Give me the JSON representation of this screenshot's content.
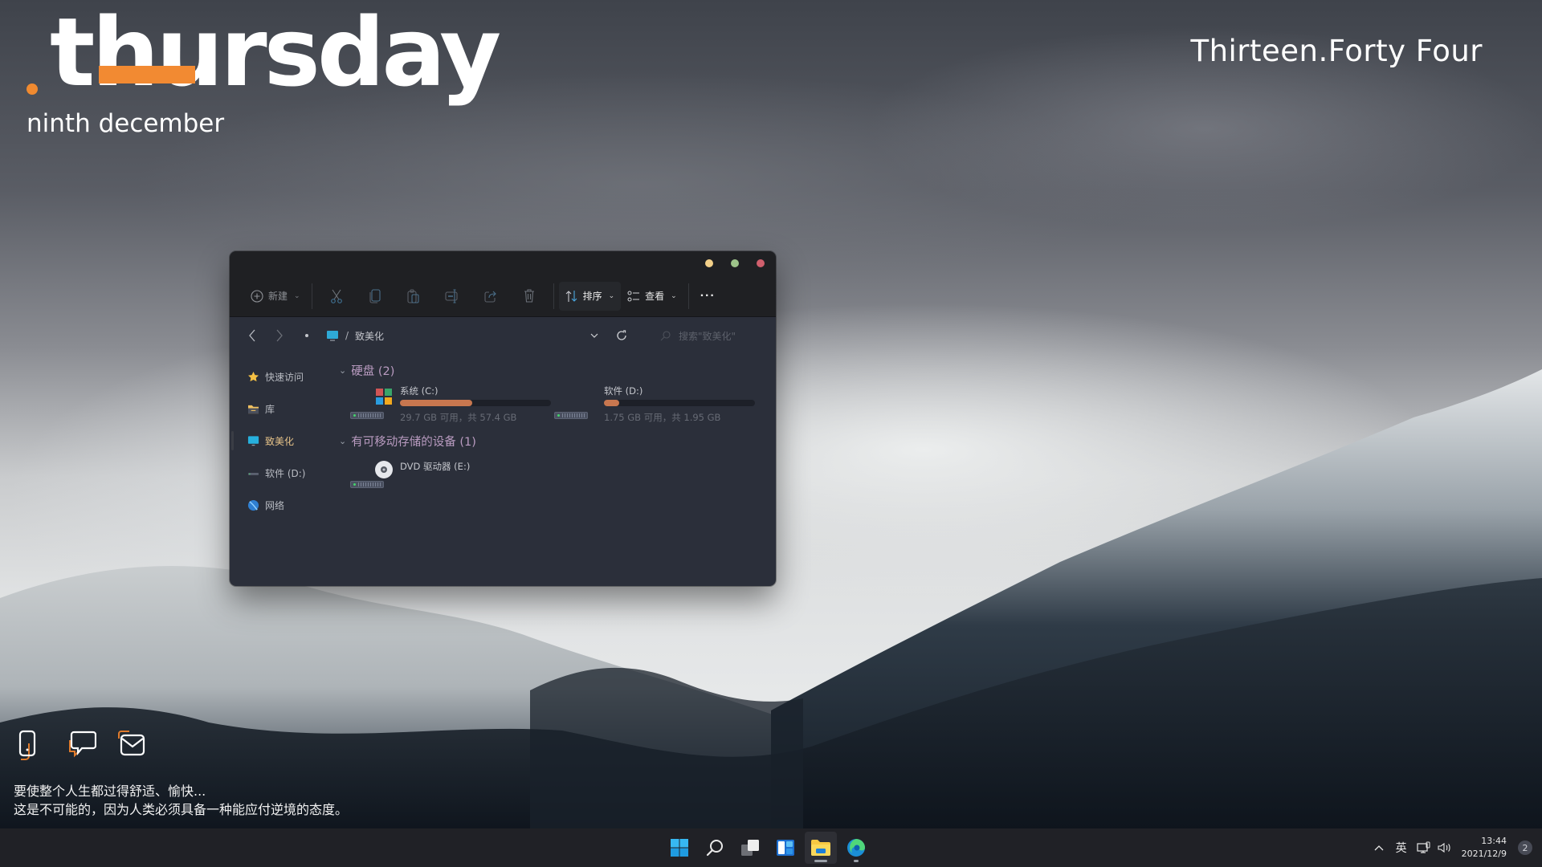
{
  "desktop": {
    "day_word": "thursday",
    "date_text": "ninth december",
    "time_text": "Thirteen.Forty Four",
    "accent_color": "#f28a32",
    "quick_icons": [
      {
        "name": "phone-icon"
      },
      {
        "name": "chat-icon"
      },
      {
        "name": "mail-icon"
      }
    ],
    "quote": {
      "line1": "要使整个人生都过得舒适、愉快...",
      "line2": "这是不可能的，因为人类必须具备一种能应付逆境的态度。"
    }
  },
  "explorer": {
    "window_buttons": [
      {
        "name": "minimize",
        "color": "#f2d089"
      },
      {
        "name": "maximize",
        "color": "#9ec48a"
      },
      {
        "name": "close",
        "color": "#d05f6d"
      }
    ],
    "toolbar": {
      "new_label": "新建",
      "sort_label": "排序",
      "view_label": "查看",
      "more_label": "···",
      "icons": [
        "cut-icon",
        "copy-icon",
        "paste-icon",
        "rename-icon",
        "share-icon",
        "delete-icon"
      ]
    },
    "address": {
      "path_separator": "/",
      "current_folder": "致美化",
      "search_placeholder": "搜索\"致美化\""
    },
    "sidebar": {
      "items": [
        {
          "label": "快速访问",
          "icon": "star-icon"
        },
        {
          "label": "库",
          "icon": "library-folder-icon"
        },
        {
          "label": "致美化",
          "icon": "desktop-monitor-icon",
          "selected": true
        },
        {
          "label": "软件 (D:)",
          "icon": "drive-icon"
        },
        {
          "label": "网络",
          "icon": "network-icon"
        }
      ]
    },
    "groups": [
      {
        "title": "硬盘 (2)",
        "drives": [
          {
            "name": "系统 (C:)",
            "info": "29.7 GB 可用，共 57.4 GB",
            "used_fraction": 0.48,
            "icon": "windows-drive-icon"
          },
          {
            "name": "软件 (D:)",
            "info": "1.75 GB 可用，共 1.95 GB",
            "used_fraction": 0.1,
            "icon": "drive-icon"
          }
        ]
      },
      {
        "title": "有可移动存储的设备 (1)",
        "drives": [
          {
            "name": "DVD 驱动器 (E:)",
            "icon": "dvd-icon"
          }
        ]
      }
    ]
  },
  "taskbar": {
    "apps": [
      {
        "name": "start",
        "icon": "windows-start-icon"
      },
      {
        "name": "search",
        "icon": "search-icon"
      },
      {
        "name": "task-view",
        "icon": "task-view-icon"
      },
      {
        "name": "widgets",
        "icon": "widgets-icon"
      },
      {
        "name": "file-explorer",
        "icon": "folder-icon",
        "active": true
      },
      {
        "name": "edge",
        "icon": "edge-browser-icon",
        "running": true
      }
    ],
    "tray": {
      "overflow_chevron": "^",
      "ime": "英",
      "time": "13:44",
      "date": "2021/12/9",
      "notification_count": "2"
    }
  }
}
